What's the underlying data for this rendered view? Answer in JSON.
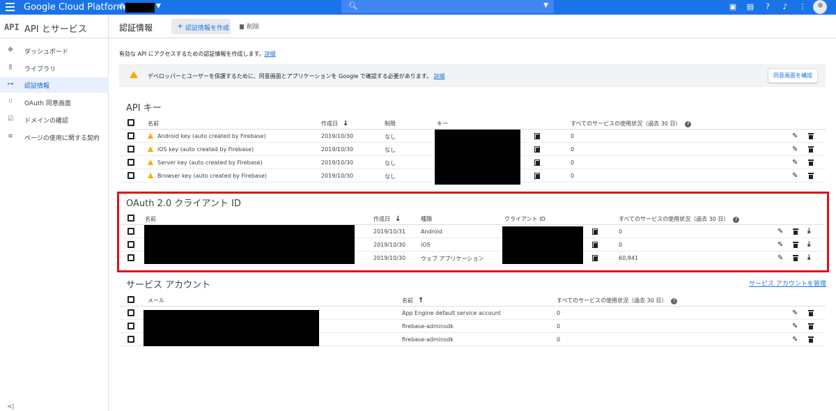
{
  "topbar": {
    "app_name": "Google Cloud Platform",
    "project_caret": "▼",
    "search_caret": "▼",
    "icons": [
      "menu-icon",
      "gift-icon",
      "terminal-icon",
      "help-icon",
      "notifications-icon",
      "more-vert-icon",
      "account-icon"
    ]
  },
  "sidebar": {
    "logo": "API",
    "title": "API とサービス",
    "items": [
      {
        "label": "ダッシュボード",
        "icon": "✥"
      },
      {
        "label": "ライブラリ",
        "icon": "⫼"
      },
      {
        "label": "認証情報",
        "icon": "⊶"
      },
      {
        "label": "OAuth 同意画面",
        "icon": "⁝⁝"
      },
      {
        "label": "ドメインの確認",
        "icon": "☑"
      },
      {
        "label": "ページの使用に関する契約",
        "icon": "≡"
      }
    ],
    "collapse": "<|"
  },
  "header": {
    "title": "認証情報",
    "create_label": "認証情報を作成",
    "create_plus": "+",
    "delete_label": "削除"
  },
  "intro": {
    "text": "有効な API にアクセスするための認証情報を作成します。",
    "link": "詳細"
  },
  "warning": {
    "text": "デベロッパーとユーザーを保護するために、同意画面とアプリケーションを Google で確認する必要があります。",
    "link": "詳細",
    "button": "同意画面を構成"
  },
  "api_keys": {
    "title": "API キー",
    "headers": {
      "name": "名前",
      "created": "作成日",
      "restriction": "制限",
      "key": "キー",
      "usage": "すべてのサービスの使用状況（過去 30 日）"
    },
    "rows": [
      {
        "name": "Android key (auto created by Firebase)",
        "created": "2019/10/30",
        "restriction": "なし",
        "usage": "0"
      },
      {
        "name": "iOS key (auto created by Firebase)",
        "created": "2019/10/30",
        "restriction": "なし",
        "usage": "0"
      },
      {
        "name": "Server key (auto created by Firebase)",
        "created": "2019/10/30",
        "restriction": "なし",
        "usage": "0"
      },
      {
        "name": "Browser key (auto created by Firebase)",
        "created": "2019/10/30",
        "restriction": "なし",
        "usage": "0"
      }
    ]
  },
  "oauth": {
    "title": "OAuth 2.0 クライアント ID",
    "headers": {
      "name": "名前",
      "created": "作成日",
      "type": "種類",
      "client_id": "クライアント ID",
      "usage": "すべてのサービスの使用状況（過去 30 日）"
    },
    "rows": [
      {
        "created": "2019/10/31",
        "type": "Android",
        "usage": "0"
      },
      {
        "created": "2019/10/30",
        "type": "iOS",
        "usage": "0"
      },
      {
        "created": "2019/10/30",
        "type": "ウェブ アプリケーション",
        "usage": "60,841"
      }
    ]
  },
  "service_accounts": {
    "title": "サービス アカウント",
    "manage_link": "サービス アカウントを管理",
    "headers": {
      "email": "メール",
      "name": "名前",
      "usage": "すべてのサービスの使用状況（過去 30 日）"
    },
    "rows": [
      {
        "name": "App Engine default service account",
        "usage": "0"
      },
      {
        "name": "firebase-adminsdk",
        "usage": "0"
      },
      {
        "name": "firebase-adminsdk",
        "usage": "0"
      }
    ]
  },
  "glyphs": {
    "down_arrow": "↓",
    "up_arrow": "↑",
    "help": "?",
    "edit": "✎",
    "download": "⤓"
  }
}
